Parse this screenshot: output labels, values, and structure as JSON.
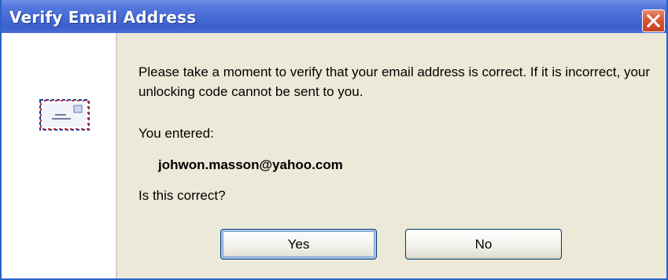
{
  "window": {
    "title": "Verify Email Address",
    "close_icon": "close-x-icon"
  },
  "icon": {
    "name": "envelope-icon"
  },
  "message": {
    "body": "Please take a moment to verify that your email address is correct. If it is incorrect, your unlocking code cannot be sent to you.",
    "entered_label": "You entered:",
    "email": "johwon.masson@yahoo.com",
    "question": "Is this correct?"
  },
  "buttons": {
    "yes_label": "Yes",
    "no_label": "No"
  },
  "colors": {
    "titlebar": "#4569d4",
    "close_button": "#d8573a",
    "dialog_background": "#ece9d8",
    "button_border": "#003c74"
  }
}
